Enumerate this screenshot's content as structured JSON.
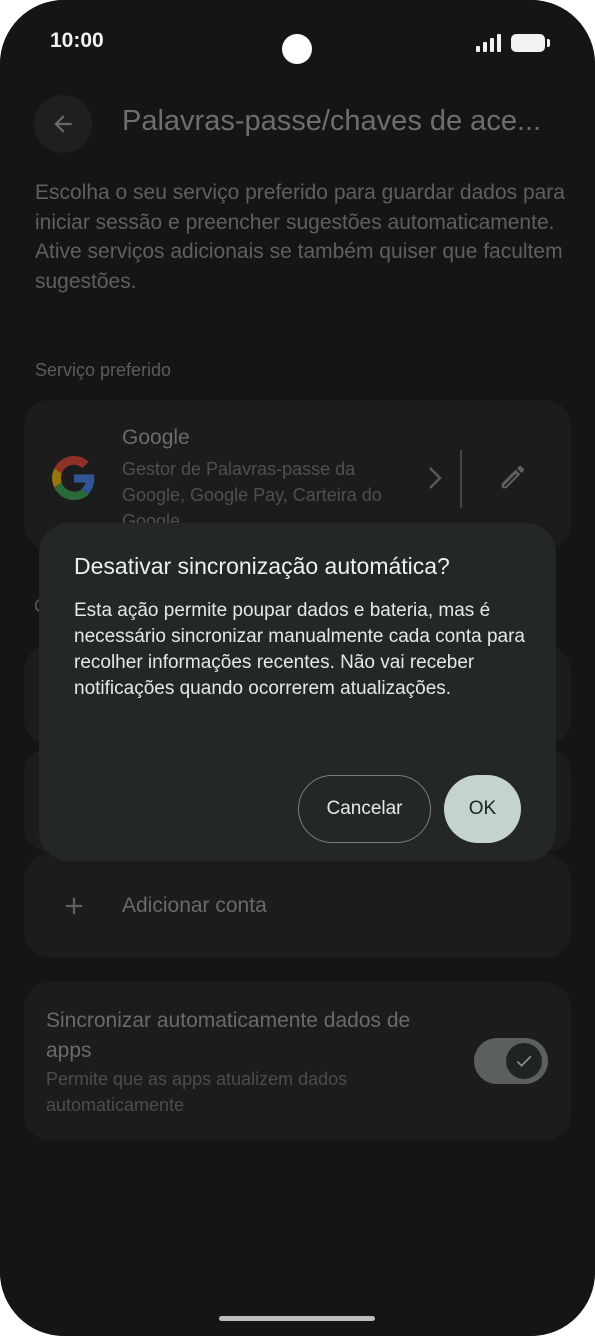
{
  "status_bar": {
    "time": "10:00"
  },
  "header": {
    "title": "Palavras-passe/chaves de ace..."
  },
  "description": "Escolha o seu serviço preferido para guardar dados para iniciar sessão e preencher sugestões automaticamente. Ative serviços adicionais se também quiser que facultem sugestões.",
  "preferred_section": {
    "label": "Serviço preferido",
    "service_name": "Google",
    "service_subtitle": "Gestor de Palavras-passe da Google, Google Pay, Carteira do Google"
  },
  "accounts_section": {
    "partial_label": "C",
    "add_account_label": "Adicionar conta"
  },
  "auto_sync": {
    "title": "Sincronizar automaticamente dados de apps",
    "subtitle": "Permite que as apps atualizem dados automaticamente",
    "enabled": true
  },
  "dialog": {
    "title": "Desativar sincronização automática?",
    "body": "Esta ação permite poupar dados e bateria, mas é necessário sincronizar manualmente cada conta para recolher informações recentes. Não vai receber notificações quando ocorrerem atualizações.",
    "cancel_label": "Cancelar",
    "ok_label": "OK"
  },
  "colors": {
    "screen_bg": "#151515",
    "dialog_bg": "#232726",
    "ok_button_bg": "#c5d3cd"
  },
  "icons": [
    "back-arrow-icon",
    "google-logo-icon",
    "chevron-right-icon",
    "pencil-icon",
    "plus-icon",
    "check-icon",
    "signal-icon",
    "battery-icon"
  ]
}
